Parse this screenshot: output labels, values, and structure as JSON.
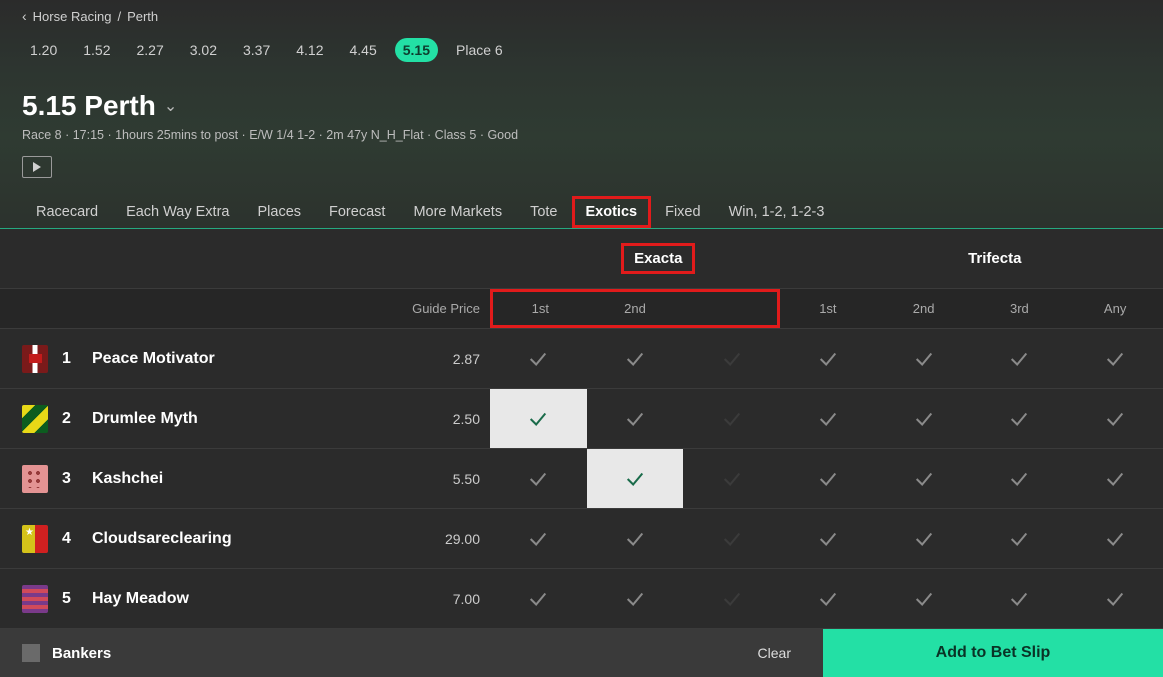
{
  "breadcrumb": {
    "parent": "Horse Racing",
    "track": "Perth"
  },
  "times": [
    "1.20",
    "1.52",
    "2.27",
    "3.02",
    "3.37",
    "4.12",
    "4.45",
    "5.15"
  ],
  "active_time_index": 7,
  "place_label": "Place 6",
  "title": "5.15 Perth",
  "subtitle": "Race 8 · 17:15 · 1hours 25mins to post · E/W 1/4 1-2 · 2m 47y N_H_Flat · Class 5 · Good",
  "tabs": [
    "Racecard",
    "Each Way Extra",
    "Places",
    "Forecast",
    "More Markets",
    "Tote",
    "Exotics",
    "Fixed",
    "Win, 1-2, 1-2-3"
  ],
  "active_tab_index": 6,
  "exotic_types": {
    "exacta": "Exacta",
    "trifecta": "Trifecta"
  },
  "col_labels": {
    "guide": "Guide Price",
    "first": "1st",
    "second": "2nd",
    "third": "3rd",
    "any": "Any"
  },
  "runners": [
    {
      "num": "1",
      "name": "Peace Motivator",
      "guide": "2.87",
      "silk": "silk1",
      "exacta": [
        "",
        "",
        ""
      ],
      "trifecta": [
        "",
        "",
        "",
        ""
      ]
    },
    {
      "num": "2",
      "name": "Drumlee Myth",
      "guide": "2.50",
      "silk": "silk2",
      "exacta": [
        "sel",
        "",
        ""
      ],
      "trifecta": [
        "",
        "",
        "",
        ""
      ]
    },
    {
      "num": "3",
      "name": "Kashchei",
      "guide": "5.50",
      "silk": "silk3",
      "exacta": [
        "",
        "sel",
        ""
      ],
      "trifecta": [
        "",
        "",
        "",
        ""
      ]
    },
    {
      "num": "4",
      "name": "Cloudsareclearing",
      "guide": "29.00",
      "silk": "silk4",
      "exacta": [
        "",
        "",
        ""
      ],
      "trifecta": [
        "",
        "",
        "",
        ""
      ]
    },
    {
      "num": "5",
      "name": "Hay Meadow",
      "guide": "7.00",
      "silk": "silk5",
      "exacta": [
        "",
        "",
        ""
      ],
      "trifecta": [
        "",
        "",
        "",
        ""
      ]
    }
  ],
  "footer": {
    "bankers": "Bankers",
    "clear": "Clear",
    "add": "Add to Bet Slip"
  }
}
